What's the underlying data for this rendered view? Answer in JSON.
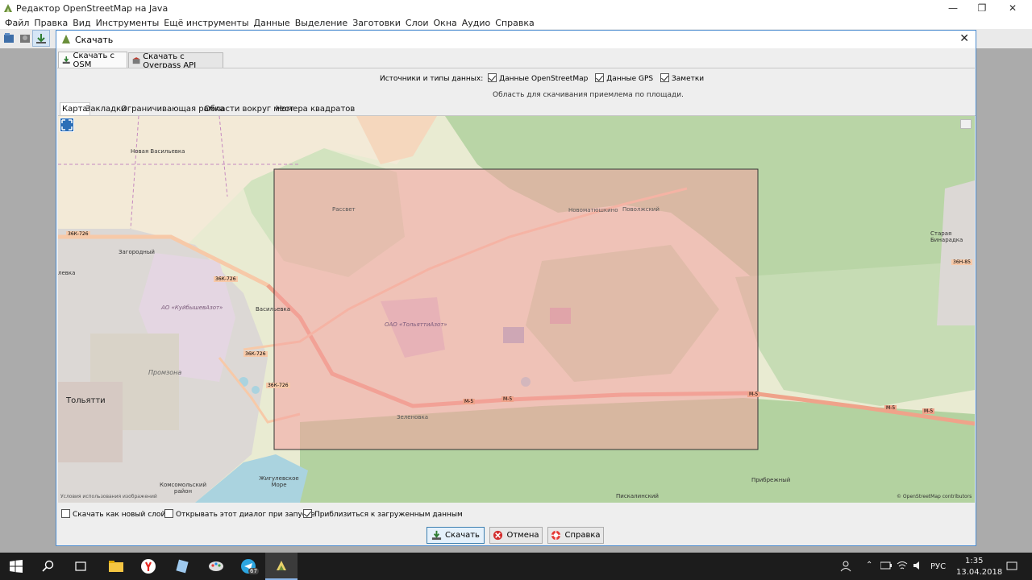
{
  "app": {
    "title": "Редактор OpenStreetMap на Java",
    "menu": [
      "Файл",
      "Правка",
      "Вид",
      "Инструменты",
      "Ещё инструменты",
      "Данные",
      "Выделение",
      "Заготовки",
      "Слои",
      "Окна",
      "Аудио",
      "Справка"
    ]
  },
  "dialog": {
    "title": "Скачать",
    "tabs": [
      "Скачать с OSM",
      "Скачать с Overpass API"
    ],
    "sources_label": "Источники и типы данных:",
    "sources": [
      {
        "label": "Данные OpenStreetMap",
        "checked": true
      },
      {
        "label": "Данные GPS",
        "checked": true
      },
      {
        "label": "Заметки",
        "checked": true
      }
    ],
    "area_status": "Область для скачивания приемлема по площади.",
    "subtabs": [
      "Карта",
      "Закладки",
      "Ограничивающая рамка",
      "Области вокруг мест",
      "Номера квадратов"
    ],
    "map": {
      "places": [
        "Новая Васильевка",
        "Рассвет",
        "Новоматюшкино",
        "Поволжский",
        "Загородный",
        "Васильевка",
        "АО «КуйбышевАзот»",
        "ОАО «ТольяттиАзот»",
        "Промзона",
        "Тольятти",
        "Зеленовка",
        "Жигулевское Море",
        "Комсомольский район",
        "Прибрежный",
        "Пискалинский",
        "Старая Бинарадка"
      ],
      "roads": [
        "36К-726",
        "36К-726",
        "36К-726",
        "36К-726",
        "М-5",
        "М-5",
        "М-5",
        "М-5",
        "М-5",
        "36Н-85"
      ],
      "left_edge_label": "левка",
      "attribution_left": "Условия использования изображений",
      "attribution_right": "© OpenStreetMap contributors"
    },
    "options": [
      {
        "label": "Скачать как новый слой",
        "checked": false
      },
      {
        "label": "Открывать этот диалог при запуске",
        "checked": false
      },
      {
        "label": "Приблизиться к загруженным данным",
        "checked": true
      }
    ],
    "buttons": {
      "download": "Скачать",
      "cancel": "Отмена",
      "help": "Справка"
    }
  },
  "taskbar": {
    "lang": "РУС",
    "time": "1:35",
    "date": "13.04.2018",
    "telegram_badge": "67"
  },
  "colors": {
    "selection_fill": "#f4a0a0",
    "forest": "#add19e",
    "residential": "#e0dfdf",
    "industrial": "#ebdbe8",
    "primary_road": "#f9b29c",
    "water": "#aad3df",
    "farmland": "#eef0d5"
  }
}
